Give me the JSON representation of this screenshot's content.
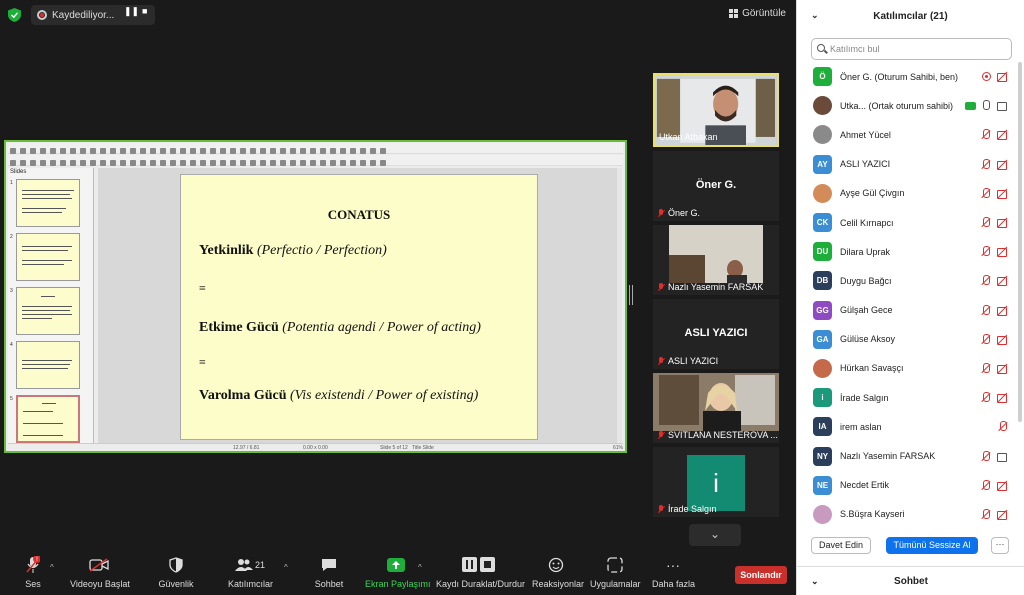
{
  "recording": {
    "status_label": "Kaydediliyor..."
  },
  "view_button": {
    "label": "Görüntüle"
  },
  "presentation": {
    "slides_pane_title": "Slides",
    "slide_title": "CONATUS",
    "line1_bold": "Yetkinlik",
    "line1_italic": "(Perfectio / Perfection)",
    "equiv": "≡",
    "line2_bold": "Etkime Gücü",
    "line2_italic": "(Potentia agendi / Power of acting)",
    "line3_bold": "Varolma Gücü",
    "line3_italic": "(Vis existendi / Power of existing)",
    "status_pos": "12.97 / 6.81",
    "status_size": "0.00 x 0.00",
    "status_slide": "Slide 5 of 12",
    "status_layout": "Title Slide",
    "status_zoom": "61%"
  },
  "tiles": [
    {
      "name": "Utkan Atbakan",
      "active": true
    },
    {
      "name": "Öner G.",
      "big": "Öner G."
    },
    {
      "name": "Nazlı Yasemin FARSAK"
    },
    {
      "name": "ASLI YAZICI",
      "big": "ASLI YAZICI"
    },
    {
      "name": "SVITLANA NESTEROVA ..."
    },
    {
      "name": "İrade Salgın",
      "initial": "i"
    }
  ],
  "toolbar": {
    "audio": "Ses",
    "video": "Videoyu Başlat",
    "security": "Güvenlik",
    "participants": "Katılımcılar",
    "participants_count": "21",
    "chat": "Sohbet",
    "share": "Ekran Paylaşımı",
    "record": "Kaydı Duraklat/Durdur",
    "reactions": "Reaksiyonlar",
    "apps": "Uygulamalar",
    "more": "Daha fazla",
    "end": "Sonlandır"
  },
  "panel": {
    "title": "Katılımcılar (21)",
    "search_placeholder": "Katılımcı bul",
    "participants": [
      {
        "initials": "Ö",
        "color": "#1eaf3a",
        "name": "Öner G. (Oturum Sahibi, ben)"
      },
      {
        "initials": "",
        "color": "#6b4a3a",
        "name": "Utka...  (Ortak oturum sahibi)"
      },
      {
        "initials": "",
        "color": "#8a8a8a",
        "name": "Ahmet Yücel"
      },
      {
        "initials": "AY",
        "color": "#3b8ed4",
        "name": "ASLI YAZICI"
      },
      {
        "initials": "",
        "color": "#d48b5a",
        "name": "Ayşe Gül Çivgın"
      },
      {
        "initials": "CK",
        "color": "#3b8ed4",
        "name": "Celil Kırnapcı"
      },
      {
        "initials": "DU",
        "color": "#1eaf3a",
        "name": "Dilara Uprak"
      },
      {
        "initials": "DB",
        "color": "#2b3f5c",
        "name": "Duygu Bağcı"
      },
      {
        "initials": "GG",
        "color": "#8e4bc4",
        "name": "Gülşah Gece"
      },
      {
        "initials": "GA",
        "color": "#3b8ed4",
        "name": "Gülüse Aksoy"
      },
      {
        "initials": "",
        "color": "#c46a4b",
        "name": "Hürkan Savaşçı"
      },
      {
        "initials": "i",
        "color": "#1a9a7a",
        "name": "İrade Salgın"
      },
      {
        "initials": "IA",
        "color": "#2b3f5c",
        "name": "irem aslan"
      },
      {
        "initials": "NY",
        "color": "#2b3f5c",
        "name": "Nazlı Yasemin FARSAK"
      },
      {
        "initials": "NE",
        "color": "#3b8ed4",
        "name": "Necdet Ertik"
      },
      {
        "initials": "",
        "color": "#c89ac0",
        "name": "S.Büşra Kayseri"
      }
    ],
    "invite_label": "Davet Edin",
    "mute_all_label": "Tümünü Sessize Al",
    "more_label": "···",
    "chat_title": "Sohbet"
  }
}
